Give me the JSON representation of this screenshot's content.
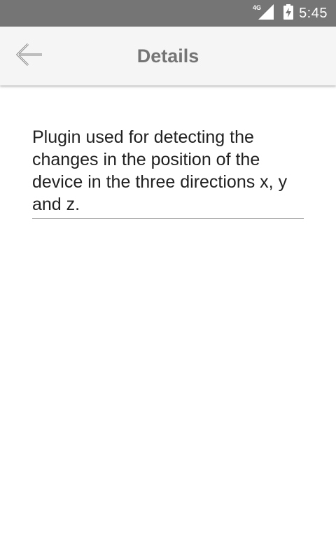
{
  "status_bar": {
    "network_type": "4G",
    "time": "5:45",
    "icons": [
      "signal-icon",
      "battery-charging-icon"
    ]
  },
  "app_bar": {
    "title": "Details",
    "back_icon": "arrow-back-icon"
  },
  "content": {
    "description": "Plugin used for detecting the changes in the position of the device in the three directions x, y and z."
  },
  "colors": {
    "status_bar": "#757575",
    "app_bar": "#f5f5f5",
    "title_text": "#757575",
    "body_text": "#212121",
    "underline": "#8a8a8a"
  }
}
